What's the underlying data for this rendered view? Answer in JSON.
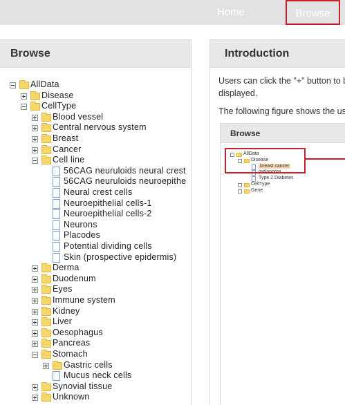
{
  "nav": {
    "home": "Home",
    "browse": "Browse"
  },
  "browse_panel": {
    "title": "Browse",
    "tree": [
      {
        "label": "AllData",
        "level": 0,
        "kind": "folder",
        "toggle": "minus"
      },
      {
        "label": "Disease",
        "level": 1,
        "kind": "folder",
        "toggle": "plus"
      },
      {
        "label": "CellType",
        "level": 1,
        "kind": "folder",
        "toggle": "minus"
      },
      {
        "label": "Blood vessel",
        "level": 2,
        "kind": "folder",
        "toggle": "plus"
      },
      {
        "label": "Central nervous system",
        "level": 2,
        "kind": "folder",
        "toggle": "plus"
      },
      {
        "label": "Breast",
        "level": 2,
        "kind": "folder",
        "toggle": "plus"
      },
      {
        "label": "Cancer",
        "level": 2,
        "kind": "folder",
        "toggle": "plus"
      },
      {
        "label": "Cell line",
        "level": 2,
        "kind": "folder",
        "toggle": "minus"
      },
      {
        "label": "56CAG neuruloids neural crest",
        "level": 3,
        "kind": "file"
      },
      {
        "label": "56CAG neuruloids neuroepithe",
        "level": 3,
        "kind": "file"
      },
      {
        "label": "Neural crest cells",
        "level": 3,
        "kind": "file"
      },
      {
        "label": "Neuroepithelial cells-1",
        "level": 3,
        "kind": "file"
      },
      {
        "label": "Neuroepithelial cells-2",
        "level": 3,
        "kind": "file"
      },
      {
        "label": "Neurons",
        "level": 3,
        "kind": "file"
      },
      {
        "label": "Placodes",
        "level": 3,
        "kind": "file"
      },
      {
        "label": "Potential dividing cells",
        "level": 3,
        "kind": "file"
      },
      {
        "label": "Skin (prospective epidermis)",
        "level": 3,
        "kind": "file"
      },
      {
        "label": "Derma",
        "level": 2,
        "kind": "folder",
        "toggle": "plus"
      },
      {
        "label": "Duodenum",
        "level": 2,
        "kind": "folder",
        "toggle": "plus"
      },
      {
        "label": "Eyes",
        "level": 2,
        "kind": "folder",
        "toggle": "plus"
      },
      {
        "label": "Immune system",
        "level": 2,
        "kind": "folder",
        "toggle": "plus"
      },
      {
        "label": "Kidney",
        "level": 2,
        "kind": "folder",
        "toggle": "plus"
      },
      {
        "label": "Liver",
        "level": 2,
        "kind": "folder",
        "toggle": "plus"
      },
      {
        "label": "Oesophagus",
        "level": 2,
        "kind": "folder",
        "toggle": "plus"
      },
      {
        "label": "Pancreas",
        "level": 2,
        "kind": "folder",
        "toggle": "plus"
      },
      {
        "label": "Stomach",
        "level": 2,
        "kind": "folder",
        "toggle": "minus"
      },
      {
        "label": "Gastric cells",
        "level": 3,
        "kind": "folder",
        "toggle": "plus"
      },
      {
        "label": "Mucus neck cells",
        "level": 3,
        "kind": "file"
      },
      {
        "label": "Synovial tissue",
        "level": 2,
        "kind": "folder",
        "toggle": "plus"
      },
      {
        "label": "Unknown",
        "level": 2,
        "kind": "folder",
        "toggle": "plus"
      }
    ]
  },
  "intro_panel": {
    "title": "Introduction",
    "line1": "Users can click the \"+\" button to b",
    "line2": "displayed.",
    "line3": "The following figure shows the usa",
    "figure": {
      "title": "Browse",
      "tree": [
        {
          "label": "AllData",
          "level": 0,
          "kind": "folder",
          "toggle": "minus"
        },
        {
          "label": "Disease",
          "level": 1,
          "kind": "folder",
          "toggle": "minus"
        },
        {
          "label": "breast cancer",
          "level": 2,
          "kind": "file",
          "selected": true
        },
        {
          "label": "melanoma",
          "level": 2,
          "kind": "file"
        },
        {
          "label": "Type 2 Diabetes",
          "level": 2,
          "kind": "file"
        },
        {
          "label": "CellType",
          "level": 1,
          "kind": "folder",
          "toggle": "plus"
        },
        {
          "label": "Gene",
          "level": 1,
          "kind": "folder",
          "toggle": "plus"
        }
      ]
    }
  },
  "colors": {
    "highlight": "#c8202a",
    "folder": "#f5d76e",
    "header_bg": "#e8e8e8",
    "topbar_bg": "#e2e2e2"
  }
}
